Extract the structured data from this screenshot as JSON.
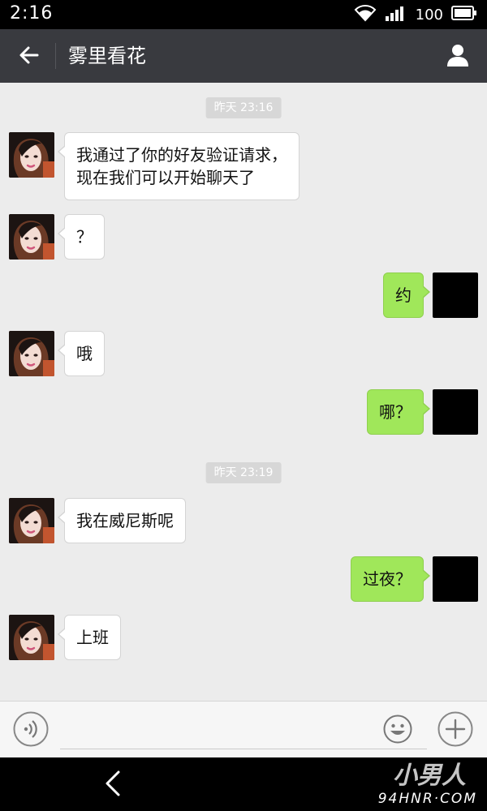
{
  "status_bar": {
    "time": "2:16",
    "battery": "100",
    "icons": [
      "wifi-icon",
      "signal-icon",
      "battery-icon"
    ]
  },
  "header": {
    "title": "雾里看花",
    "back_icon": "arrow-left-icon",
    "profile_icon": "person-icon"
  },
  "messages": [
    {
      "type": "timestamp",
      "text": "昨天 23:16"
    },
    {
      "type": "message",
      "side": "left",
      "lines": [
        "我通过了你的好友验证请求，",
        "现在我们可以开始聊天了"
      ]
    },
    {
      "type": "message",
      "side": "left",
      "lines": [
        "？"
      ]
    },
    {
      "type": "message",
      "side": "right",
      "lines": [
        "约"
      ]
    },
    {
      "type": "message",
      "side": "left",
      "lines": [
        "哦"
      ]
    },
    {
      "type": "message",
      "side": "right",
      "lines": [
        "哪？"
      ]
    },
    {
      "type": "timestamp",
      "text": "昨天 23:19"
    },
    {
      "type": "message",
      "side": "left",
      "lines": [
        "我在威尼斯呢"
      ]
    },
    {
      "type": "message",
      "side": "right",
      "lines": [
        "过夜？"
      ]
    },
    {
      "type": "message",
      "side": "left",
      "lines": [
        "上班"
      ]
    }
  ],
  "input_bar": {
    "value": "",
    "icons": [
      "voice-icon",
      "emoji-icon",
      "plus-icon"
    ]
  },
  "nav_bar": {
    "back_icon": "chevron-left-icon"
  },
  "watermark": {
    "line1": "小男人",
    "line2": "94HNR·COM"
  },
  "colors": {
    "header_bg": "#393a3f",
    "chat_bg": "#ececec",
    "sent_bubble": "#a0e75a",
    "received_bubble": "#ffffff"
  }
}
